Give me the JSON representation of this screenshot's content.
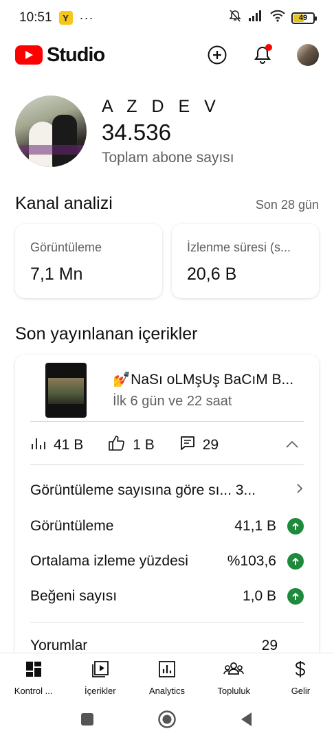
{
  "status_bar": {
    "time": "10:51",
    "app_badge": "Y",
    "more": "···",
    "battery": "49"
  },
  "app_bar": {
    "logo_text": "Studio",
    "actions": [
      "create-icon",
      "notifications-icon",
      "account-avatar"
    ]
  },
  "channel": {
    "name": "A Z D E V",
    "subscribers": "34.536",
    "subscribers_label": "Toplam abone sayısı"
  },
  "analytics": {
    "title": "Kanal analizi",
    "period": "Son 28 gün",
    "metrics": [
      {
        "label": "Görüntüleme",
        "value": "7,1 Mn"
      },
      {
        "label": "İzlenme süresi (s...",
        "value": "20,6 B"
      }
    ]
  },
  "recent": {
    "title": "Son yayınlanan içerikler",
    "video": {
      "title": "💅NaSı oLMşUş BaCıM B...",
      "age": "İlk 6 gün ve 22 saat",
      "views": "41 B",
      "likes": "1 B",
      "comments": "29"
    },
    "details": [
      {
        "label": "Görüntüleme sayısına göre sı... 3...",
        "value": ""
      },
      {
        "label": "Görüntüleme",
        "value": "41,1 B",
        "trend": "up"
      },
      {
        "label": "Ortalama izleme yüzdesi",
        "value": "%103,6",
        "trend": "up"
      },
      {
        "label": "Beğeni sayısı",
        "value": "1,0 B",
        "trend": "up"
      },
      {
        "label": "Yorumlar",
        "value": "29"
      }
    ]
  },
  "bottom_nav": [
    {
      "label": "Kontrol ...",
      "icon": "dashboard-icon"
    },
    {
      "label": "İçerikler",
      "icon": "content-icon"
    },
    {
      "label": "Analytics",
      "icon": "analytics-icon"
    },
    {
      "label": "Topluluk",
      "icon": "community-icon"
    },
    {
      "label": "Gelir",
      "icon": "earn-icon"
    }
  ],
  "colors": {
    "brand_red": "#ff0000",
    "trend_up": "#1e8a3b",
    "secondary_text": "#606060"
  }
}
